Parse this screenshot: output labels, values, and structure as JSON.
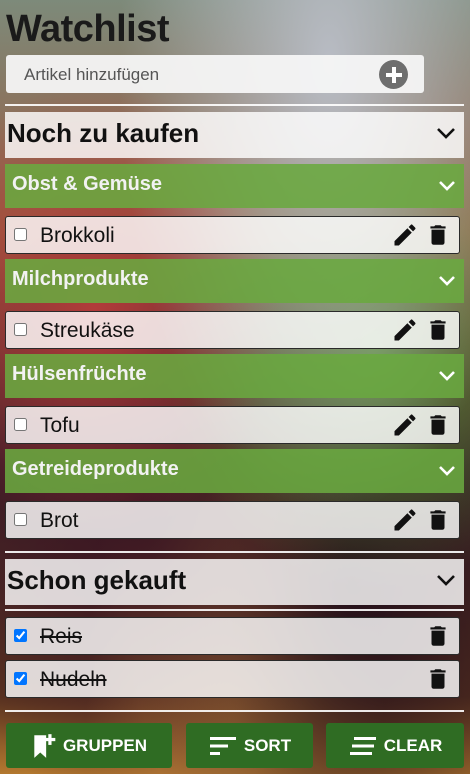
{
  "app": {
    "title": "Watchlist"
  },
  "add_item": {
    "placeholder": "Artikel hinzufügen"
  },
  "sections": {
    "to_buy": {
      "label": "Noch zu kaufen",
      "groups": [
        {
          "label": "Obst & Gemüse",
          "items": [
            {
              "name": "Brokkoli",
              "checked": false
            }
          ]
        },
        {
          "label": "Milchprodukte",
          "items": [
            {
              "name": "Streukäse",
              "checked": false
            }
          ]
        },
        {
          "label": "Hülsenfrüchte",
          "items": [
            {
              "name": "Tofu",
              "checked": false
            }
          ]
        },
        {
          "label": "Getreideprodukte",
          "items": [
            {
              "name": "Brot",
              "checked": false
            }
          ]
        }
      ]
    },
    "bought": {
      "label": "Schon gekauft",
      "items": [
        {
          "name": "Reis",
          "checked": true
        },
        {
          "name": "Nudeln",
          "checked": true
        }
      ]
    }
  },
  "toolbar": {
    "groups_label": "GRUPPEN",
    "sort_label": "SORT",
    "clear_label": "CLEAR"
  },
  "colors": {
    "group_header": "#6aa840",
    "toolbar_button": "#2f6c23"
  }
}
